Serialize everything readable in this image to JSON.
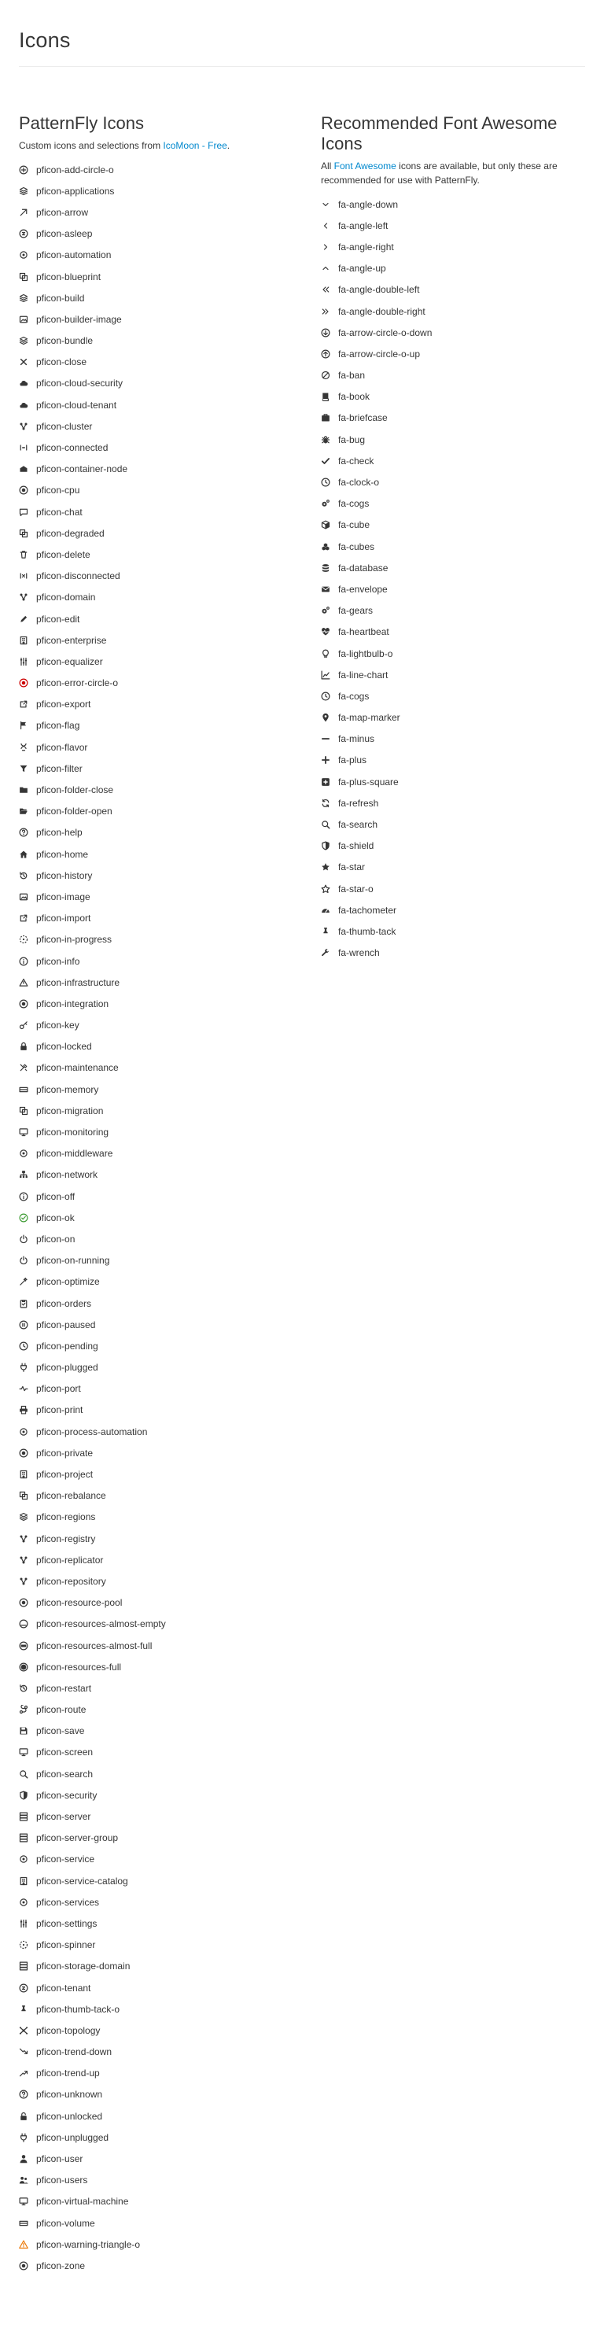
{
  "page": {
    "title": "Icons"
  },
  "left": {
    "title": "PatternFly Icons",
    "desc_prefix": "Custom icons and selections from ",
    "desc_link": "IcoMoon - Free",
    "desc_suffix": ".",
    "icons": [
      {
        "label": "pficon-add-circle-o",
        "icon": "add-circle-o-icon",
        "shape": "circle-plus",
        "color": "#363636"
      },
      {
        "label": "pficon-applications",
        "icon": "applications-icon",
        "shape": "stack",
        "color": "#363636"
      },
      {
        "label": "pficon-arrow",
        "icon": "arrow-icon",
        "shape": "arrow-ne",
        "color": "#363636"
      },
      {
        "label": "pficon-asleep",
        "icon": "asleep-icon",
        "shape": "circle-z",
        "color": "#363636"
      },
      {
        "label": "pficon-automation",
        "icon": "automation-icon",
        "shape": "gear-dot",
        "color": "#363636"
      },
      {
        "label": "pficon-blueprint",
        "icon": "blueprint-icon",
        "shape": "squares",
        "color": "#363636"
      },
      {
        "label": "pficon-build",
        "icon": "build-icon",
        "shape": "stack",
        "color": "#363636"
      },
      {
        "label": "pficon-builder-image",
        "icon": "builder-image-icon",
        "shape": "stack-image",
        "color": "#363636"
      },
      {
        "label": "pficon-bundle",
        "icon": "bundle-icon",
        "shape": "stack",
        "color": "#363636"
      },
      {
        "label": "pficon-close",
        "icon": "close-icon",
        "shape": "x",
        "color": "#363636"
      },
      {
        "label": "pficon-cloud-security",
        "icon": "cloud-security-icon",
        "shape": "cloud",
        "color": "#363636"
      },
      {
        "label": "pficon-cloud-tenant",
        "icon": "cloud-tenant-icon",
        "shape": "cloud",
        "color": "#363636"
      },
      {
        "label": "pficon-cluster",
        "icon": "cluster-icon",
        "shape": "cluster",
        "color": "#363636"
      },
      {
        "label": "pficon-connected",
        "icon": "connected-icon",
        "shape": "connected",
        "color": "#363636"
      },
      {
        "label": "pficon-container-node",
        "icon": "container-node-icon",
        "shape": "container",
        "color": "#363636"
      },
      {
        "label": "pficon-cpu",
        "icon": "cpu-icon",
        "shape": "target",
        "color": "#363636"
      },
      {
        "label": "pficon-chat",
        "icon": "chat-icon",
        "shape": "chat",
        "color": "#363636"
      },
      {
        "label": "pficon-degraded",
        "icon": "degraded-icon",
        "shape": "squares",
        "color": "#363636"
      },
      {
        "label": "pficon-delete",
        "icon": "delete-icon",
        "shape": "trash",
        "color": "#363636"
      },
      {
        "label": "pficon-disconnected",
        "icon": "disconnected-icon",
        "shape": "disconnected",
        "color": "#363636"
      },
      {
        "label": "pficon-domain",
        "icon": "domain-icon",
        "shape": "cluster",
        "color": "#363636"
      },
      {
        "label": "pficon-edit",
        "icon": "edit-icon",
        "shape": "pencil",
        "color": "#363636"
      },
      {
        "label": "pficon-enterprise",
        "icon": "enterprise-icon",
        "shape": "building",
        "color": "#363636"
      },
      {
        "label": "pficon-equalizer",
        "icon": "equalizer-icon",
        "shape": "sliders",
        "color": "#363636"
      },
      {
        "label": "pficon-error-circle-o",
        "icon": "error-circle-o-icon",
        "shape": "error-circle",
        "color": "#cc0000"
      },
      {
        "label": "pficon-export",
        "icon": "export-icon",
        "shape": "box-arrow",
        "color": "#363636"
      },
      {
        "label": "pficon-flag",
        "icon": "flag-icon",
        "shape": "flag",
        "color": "#363636"
      },
      {
        "label": "pficon-flavor",
        "icon": "flavor-icon",
        "shape": "flavor",
        "color": "#363636"
      },
      {
        "label": "pficon-filter",
        "icon": "filter-icon",
        "shape": "filter",
        "color": "#363636"
      },
      {
        "label": "pficon-folder-close",
        "icon": "folder-close-icon",
        "shape": "folder",
        "color": "#363636"
      },
      {
        "label": "pficon-folder-open",
        "icon": "folder-open-icon",
        "shape": "folder-open",
        "color": "#363636"
      },
      {
        "label": "pficon-help",
        "icon": "help-icon",
        "shape": "circle-q",
        "color": "#363636"
      },
      {
        "label": "pficon-home",
        "icon": "home-icon",
        "shape": "home",
        "color": "#363636"
      },
      {
        "label": "pficon-history",
        "icon": "history-icon",
        "shape": "history",
        "color": "#363636"
      },
      {
        "label": "pficon-image",
        "icon": "image-icon",
        "shape": "stack-image",
        "color": "#363636"
      },
      {
        "label": "pficon-import",
        "icon": "import-icon",
        "shape": "box-arrow",
        "color": "#363636"
      },
      {
        "label": "pficon-in-progress",
        "icon": "in-progress-icon",
        "shape": "dashed-circle",
        "color": "#363636"
      },
      {
        "label": "pficon-info",
        "icon": "info-icon",
        "shape": "circle-i",
        "color": "#363636"
      },
      {
        "label": "pficon-infrastructure",
        "icon": "infrastructure-icon",
        "shape": "triangle",
        "color": "#363636"
      },
      {
        "label": "pficon-integration",
        "icon": "integration-icon",
        "shape": "target",
        "color": "#363636"
      },
      {
        "label": "pficon-key",
        "icon": "key-icon",
        "shape": "key",
        "color": "#363636"
      },
      {
        "label": "pficon-locked",
        "icon": "locked-icon",
        "shape": "lock",
        "color": "#363636"
      },
      {
        "label": "pficon-maintenance",
        "icon": "maintenance-icon",
        "shape": "tools",
        "color": "#363636"
      },
      {
        "label": "pficon-memory",
        "icon": "memory-icon",
        "shape": "memory",
        "color": "#363636"
      },
      {
        "label": "pficon-migration",
        "icon": "migration-icon",
        "shape": "squares",
        "color": "#363636"
      },
      {
        "label": "pficon-monitoring",
        "icon": "monitoring-icon",
        "shape": "monitor",
        "color": "#363636"
      },
      {
        "label": "pficon-middleware",
        "icon": "middleware-icon",
        "shape": "gear-dot",
        "color": "#363636"
      },
      {
        "label": "pficon-network",
        "icon": "network-icon",
        "shape": "network",
        "color": "#363636"
      },
      {
        "label": "pficon-off",
        "icon": "off-icon",
        "shape": "circle-i",
        "color": "#363636"
      },
      {
        "label": "pficon-ok",
        "icon": "ok-icon",
        "shape": "ok-circle",
        "color": "#3f9c35"
      },
      {
        "label": "pficon-on",
        "icon": "on-icon",
        "shape": "power",
        "color": "#363636"
      },
      {
        "label": "pficon-on-running",
        "icon": "on-running-icon",
        "shape": "power",
        "color": "#363636"
      },
      {
        "label": "pficon-optimize",
        "icon": "optimize-icon",
        "shape": "optimize",
        "color": "#363636"
      },
      {
        "label": "pficon-orders",
        "icon": "orders-icon",
        "shape": "clipboard",
        "color": "#363636"
      },
      {
        "label": "pficon-paused",
        "icon": "paused-icon",
        "shape": "paused",
        "color": "#363636"
      },
      {
        "label": "pficon-pending",
        "icon": "pending-icon",
        "shape": "clock",
        "color": "#363636"
      },
      {
        "label": "pficon-plugged",
        "icon": "plugged-icon",
        "shape": "plug",
        "color": "#363636"
      },
      {
        "label": "pficon-port",
        "icon": "port-icon",
        "shape": "pulse",
        "color": "#363636"
      },
      {
        "label": "pficon-print",
        "icon": "print-icon",
        "shape": "printer",
        "color": "#363636"
      },
      {
        "label": "pficon-process-automation",
        "icon": "process-automation-icon",
        "shape": "gear-dot",
        "color": "#363636"
      },
      {
        "label": "pficon-private",
        "icon": "private-icon",
        "shape": "target",
        "color": "#363636"
      },
      {
        "label": "pficon-project",
        "icon": "project-icon",
        "shape": "building",
        "color": "#363636"
      },
      {
        "label": "pficon-rebalance",
        "icon": "rebalance-icon",
        "shape": "squares",
        "color": "#363636"
      },
      {
        "label": "pficon-regions",
        "icon": "regions-icon",
        "shape": "stack",
        "color": "#363636"
      },
      {
        "label": "pficon-registry",
        "icon": "registry-icon",
        "shape": "cluster",
        "color": "#363636"
      },
      {
        "label": "pficon-replicator",
        "icon": "replicator-icon",
        "shape": "cluster",
        "color": "#363636"
      },
      {
        "label": "pficon-repository",
        "icon": "repository-icon",
        "shape": "cluster",
        "color": "#363636"
      },
      {
        "label": "pficon-resource-pool",
        "icon": "resource-pool-icon",
        "shape": "target",
        "color": "#363636"
      },
      {
        "label": "pficon-resources-almost-empty",
        "icon": "resources-almost-empty-icon",
        "shape": "gauge-low",
        "color": "#363636"
      },
      {
        "label": "pficon-resources-almost-full",
        "icon": "resources-almost-full-icon",
        "shape": "gauge-high",
        "color": "#363636"
      },
      {
        "label": "pficon-resources-full",
        "icon": "resources-full-icon",
        "shape": "gauge-full",
        "color": "#363636"
      },
      {
        "label": "pficon-restart",
        "icon": "restart-icon",
        "shape": "history",
        "color": "#363636"
      },
      {
        "label": "pficon-route",
        "icon": "route-icon",
        "shape": "route",
        "color": "#363636"
      },
      {
        "label": "pficon-save",
        "icon": "save-icon",
        "shape": "save",
        "color": "#363636"
      },
      {
        "label": "pficon-screen",
        "icon": "screen-icon",
        "shape": "monitor",
        "color": "#363636"
      },
      {
        "label": "pficon-search",
        "icon": "search-icon",
        "shape": "search",
        "color": "#363636"
      },
      {
        "label": "pficon-security",
        "icon": "security-icon",
        "shape": "shield",
        "color": "#363636"
      },
      {
        "label": "pficon-server",
        "icon": "server-icon",
        "shape": "server",
        "color": "#363636"
      },
      {
        "label": "pficon-server-group",
        "icon": "server-group-icon",
        "shape": "server",
        "color": "#363636"
      },
      {
        "label": "pficon-service",
        "icon": "service-icon",
        "shape": "gear-dot",
        "color": "#363636"
      },
      {
        "label": "pficon-service-catalog",
        "icon": "service-catalog-icon",
        "shape": "building",
        "color": "#363636"
      },
      {
        "label": "pficon-services",
        "icon": "services-icon",
        "shape": "gear-dot",
        "color": "#363636"
      },
      {
        "label": "pficon-settings",
        "icon": "settings-icon",
        "shape": "sliders",
        "color": "#363636"
      },
      {
        "label": "pficon-spinner",
        "icon": "spinner-icon",
        "shape": "dashed-circle",
        "color": "#363636"
      },
      {
        "label": "pficon-storage-domain",
        "icon": "storage-domain-icon",
        "shape": "server",
        "color": "#363636"
      },
      {
        "label": "pficon-tenant",
        "icon": "tenant-icon",
        "shape": "circle-z",
        "color": "#363636"
      },
      {
        "label": "pficon-thumb-tack-o",
        "icon": "thumb-tack-o-icon",
        "shape": "pin",
        "color": "#363636"
      },
      {
        "label": "pficon-topology",
        "icon": "topology-icon",
        "shape": "topology",
        "color": "#363636"
      },
      {
        "label": "pficon-trend-down",
        "icon": "trend-down-icon",
        "shape": "trend-down",
        "color": "#363636"
      },
      {
        "label": "pficon-trend-up",
        "icon": "trend-up-icon",
        "shape": "trend-up",
        "color": "#363636"
      },
      {
        "label": "pficon-unknown",
        "icon": "unknown-icon",
        "shape": "circle-q",
        "color": "#363636"
      },
      {
        "label": "pficon-unlocked",
        "icon": "unlocked-icon",
        "shape": "unlock",
        "color": "#363636"
      },
      {
        "label": "pficon-unplugged",
        "icon": "unplugged-icon",
        "shape": "plug",
        "color": "#363636"
      },
      {
        "label": "pficon-user",
        "icon": "user-icon",
        "shape": "user",
        "color": "#363636"
      },
      {
        "label": "pficon-users",
        "icon": "users-icon",
        "shape": "users",
        "color": "#363636"
      },
      {
        "label": "pficon-virtual-machine",
        "icon": "virtual-machine-icon",
        "shape": "monitor",
        "color": "#363636"
      },
      {
        "label": "pficon-volume",
        "icon": "volume-icon",
        "shape": "memory",
        "color": "#363636"
      },
      {
        "label": "pficon-warning-triangle-o",
        "icon": "warning-triangle-o-icon",
        "shape": "warning",
        "color": "#ec7a08"
      },
      {
        "label": "pficon-zone",
        "icon": "zone-icon",
        "shape": "target",
        "color": "#363636"
      }
    ]
  },
  "right": {
    "title_line1": "Recommended Font Awesome",
    "title_line2": "Icons",
    "desc_prefix": "All ",
    "desc_link": "Font Awesome",
    "desc_suffix": " icons are available, but only these are recommended for use with PatternFly.",
    "icons": [
      {
        "label": "fa-angle-down",
        "icon": "angle-down-icon",
        "shape": "chev-down",
        "color": "#363636"
      },
      {
        "label": "fa-angle-left",
        "icon": "angle-left-icon",
        "shape": "chev-left",
        "color": "#363636"
      },
      {
        "label": "fa-angle-right",
        "icon": "angle-right-icon",
        "shape": "chev-right",
        "color": "#363636"
      },
      {
        "label": "fa-angle-up",
        "icon": "angle-up-icon",
        "shape": "chev-up",
        "color": "#363636"
      },
      {
        "label": "fa-angle-double-left",
        "icon": "angle-double-left-icon",
        "shape": "dchev-left",
        "color": "#363636"
      },
      {
        "label": "fa-angle-double-right",
        "icon": "angle-double-right-icon",
        "shape": "dchev-right",
        "color": "#363636"
      },
      {
        "label": "fa-arrow-circle-o-down",
        "icon": "arrow-circle-o-down-icon",
        "shape": "circle-arrow-down",
        "color": "#363636"
      },
      {
        "label": "fa-arrow-circle-o-up",
        "icon": "arrow-circle-o-up-icon",
        "shape": "circle-arrow-up",
        "color": "#363636"
      },
      {
        "label": "fa-ban",
        "icon": "ban-icon",
        "shape": "ban",
        "color": "#363636"
      },
      {
        "label": "fa-book",
        "icon": "book-icon",
        "shape": "book",
        "color": "#363636"
      },
      {
        "label": "fa-briefcase",
        "icon": "briefcase-icon",
        "shape": "briefcase",
        "color": "#363636"
      },
      {
        "label": "fa-bug",
        "icon": "bug-icon",
        "shape": "bug",
        "color": "#363636"
      },
      {
        "label": "fa-check",
        "icon": "check-icon",
        "shape": "check",
        "color": "#363636"
      },
      {
        "label": "fa-clock-o",
        "icon": "clock-o-icon",
        "shape": "clock",
        "color": "#363636"
      },
      {
        "label": "fa-cogs",
        "icon": "cogs-icon",
        "shape": "cogs",
        "color": "#363636"
      },
      {
        "label": "fa-cube",
        "icon": "cube-icon",
        "shape": "cube",
        "color": "#363636"
      },
      {
        "label": "fa-cubes",
        "icon": "cubes-icon",
        "shape": "cubes",
        "color": "#363636"
      },
      {
        "label": "fa-database",
        "icon": "database-icon",
        "shape": "database",
        "color": "#363636"
      },
      {
        "label": "fa-envelope",
        "icon": "envelope-icon",
        "shape": "envelope",
        "color": "#363636"
      },
      {
        "label": "fa-gears",
        "icon": "gears-icon",
        "shape": "cogs",
        "color": "#363636"
      },
      {
        "label": "fa-heartbeat",
        "icon": "heartbeat-icon",
        "shape": "heartbeat",
        "color": "#363636"
      },
      {
        "label": "fa-lightbulb-o",
        "icon": "lightbulb-o-icon",
        "shape": "bulb",
        "color": "#363636"
      },
      {
        "label": "fa-line-chart",
        "icon": "line-chart-icon",
        "shape": "line-chart",
        "color": "#363636"
      },
      {
        "label": "fa-cogs",
        "icon": "cogs-icon",
        "shape": "clock",
        "color": "#363636"
      },
      {
        "label": "fa-map-marker",
        "icon": "map-marker-icon",
        "shape": "marker",
        "color": "#363636"
      },
      {
        "label": "fa-minus",
        "icon": "minus-icon",
        "shape": "minus",
        "color": "#363636"
      },
      {
        "label": "fa-plus",
        "icon": "plus-icon",
        "shape": "plus",
        "color": "#363636"
      },
      {
        "label": "fa-plus-square",
        "icon": "plus-square-icon",
        "shape": "plus-square",
        "color": "#363636"
      },
      {
        "label": "fa-refresh",
        "icon": "refresh-icon",
        "shape": "refresh",
        "color": "#363636"
      },
      {
        "label": "fa-search",
        "icon": "search-icon",
        "shape": "search",
        "color": "#363636"
      },
      {
        "label": "fa-shield",
        "icon": "shield-icon",
        "shape": "shield",
        "color": "#363636"
      },
      {
        "label": "fa-star",
        "icon": "star-icon",
        "shape": "star",
        "color": "#363636"
      },
      {
        "label": "fa-star-o",
        "icon": "star-o-icon",
        "shape": "star-o",
        "color": "#363636"
      },
      {
        "label": "fa-tachometer",
        "icon": "tachometer-icon",
        "shape": "tachometer",
        "color": "#363636"
      },
      {
        "label": "fa-thumb-tack",
        "icon": "thumb-tack-icon",
        "shape": "pin",
        "color": "#363636"
      },
      {
        "label": "fa-wrench",
        "icon": "wrench-icon",
        "shape": "wrench",
        "color": "#363636"
      }
    ]
  }
}
